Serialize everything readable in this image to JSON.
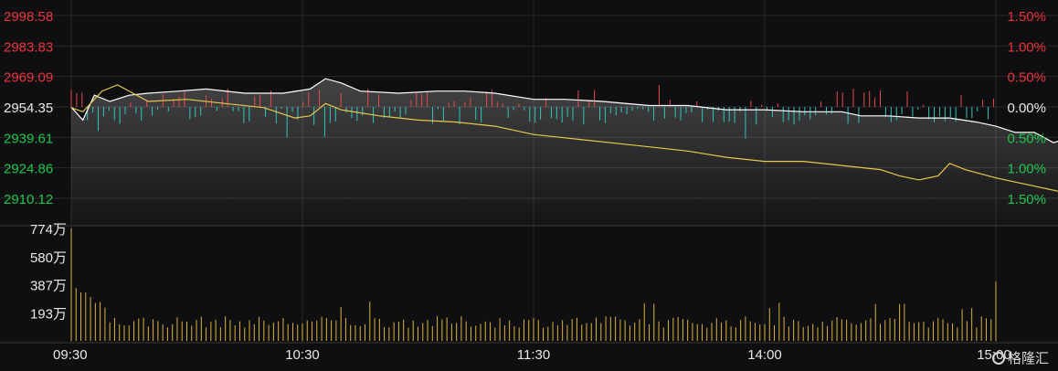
{
  "chart_data": {
    "type": "line",
    "price_axis": {
      "labels": [
        "2998.58",
        "2983.83",
        "2969.09",
        "2954.35",
        "2939.61",
        "2924.86",
        "2910.12"
      ],
      "values": [
        2998.58,
        2983.83,
        2969.09,
        2954.35,
        2939.61,
        2924.86,
        2910.12
      ],
      "base": 2954.35
    },
    "percent_axis": {
      "labels": [
        "1.50%",
        "1.00%",
        "0.50%",
        "0.00%",
        "0.50%",
        "1.00%",
        "1.50%"
      ]
    },
    "volume_axis": {
      "labels": [
        "774万",
        "580万",
        "387万",
        "193万"
      ],
      "values": [
        774,
        580,
        387,
        193
      ],
      "unit": "万"
    },
    "time_labels": [
      "09:30",
      "10:30",
      "11:30",
      "14:00",
      "15:00"
    ],
    "series": [
      {
        "color": "#ffffff",
        "points": [
          [
            0,
            2954.2
          ],
          [
            3,
            2948
          ],
          [
            6,
            2960
          ],
          [
            10,
            2957
          ],
          [
            15,
            2960
          ],
          [
            20,
            2961
          ],
          [
            28,
            2962
          ],
          [
            35,
            2963
          ],
          [
            45,
            2961
          ],
          [
            55,
            2961
          ],
          [
            62,
            2963
          ],
          [
            66,
            2968
          ],
          [
            70,
            2966
          ],
          [
            75,
            2962
          ],
          [
            85,
            2961
          ],
          [
            95,
            2962
          ],
          [
            102,
            2962
          ],
          [
            110,
            2961
          ],
          [
            120,
            2958
          ],
          [
            128,
            2958
          ],
          [
            138,
            2957
          ],
          [
            150,
            2955
          ],
          [
            160,
            2955
          ],
          [
            170,
            2953
          ],
          [
            180,
            2953
          ],
          [
            190,
            2952
          ],
          [
            200,
            2952
          ],
          [
            205,
            2950
          ],
          [
            212,
            2950
          ],
          [
            220,
            2949
          ],
          [
            228,
            2949
          ],
          [
            235,
            2947
          ],
          [
            240,
            2945
          ],
          [
            245,
            2942
          ],
          [
            250,
            2942
          ],
          [
            255,
            2937
          ],
          [
            258,
            2939
          ],
          [
            265,
            2934
          ],
          [
            270,
            2931
          ],
          [
            275,
            2932
          ],
          [
            280,
            2928
          ],
          [
            285,
            2928
          ],
          [
            288,
            2922
          ],
          [
            290,
            2923
          ],
          [
            294,
            2921
          ],
          [
            300,
            2924
          ],
          [
            304,
            2928
          ],
          [
            308,
            2930
          ],
          [
            312,
            2931
          ]
        ],
        "color_hint": "white"
      },
      {
        "color": "#e6c84a",
        "points": [
          [
            0,
            2954
          ],
          [
            3,
            2952
          ],
          [
            8,
            2962
          ],
          [
            12,
            2965
          ],
          [
            20,
            2957
          ],
          [
            30,
            2958
          ],
          [
            40,
            2956
          ],
          [
            50,
            2954
          ],
          [
            58,
            2949
          ],
          [
            62,
            2950
          ],
          [
            66,
            2956
          ],
          [
            70,
            2953
          ],
          [
            80,
            2950
          ],
          [
            90,
            2948
          ],
          [
            100,
            2947
          ],
          [
            110,
            2945
          ],
          [
            120,
            2941
          ],
          [
            130,
            2939
          ],
          [
            140,
            2937
          ],
          [
            150,
            2935
          ],
          [
            160,
            2933
          ],
          [
            170,
            2930
          ],
          [
            180,
            2928
          ],
          [
            190,
            2928
          ],
          [
            200,
            2926
          ],
          [
            210,
            2924
          ],
          [
            215,
            2921
          ],
          [
            220,
            2919
          ],
          [
            225,
            2921
          ],
          [
            228,
            2927
          ],
          [
            232,
            2924
          ],
          [
            240,
            2920
          ],
          [
            250,
            2916
          ],
          [
            260,
            2912
          ],
          [
            270,
            2910
          ],
          [
            280,
            2905
          ],
          [
            290,
            2902
          ],
          [
            294,
            2900
          ],
          [
            300,
            2905
          ],
          [
            306,
            2909
          ],
          [
            312,
            2910
          ]
        ]
      }
    ],
    "volume_max": 774,
    "total_minutes": 240
  },
  "watermark": {
    "text": "格隆汇",
    "icon": "g-logo-icon"
  },
  "colors": {
    "background": "#0f0f11",
    "up": "#e84a4a",
    "down": "#2fc7b8",
    "green_label": "#1fc64a",
    "red_label": "#e8343a",
    "neutral_label": "#e8e8e8",
    "avg_line": "#e6c84a",
    "price_line": "#ffffff",
    "volume": "#d9b43a",
    "grid": "#2a2a2d"
  }
}
